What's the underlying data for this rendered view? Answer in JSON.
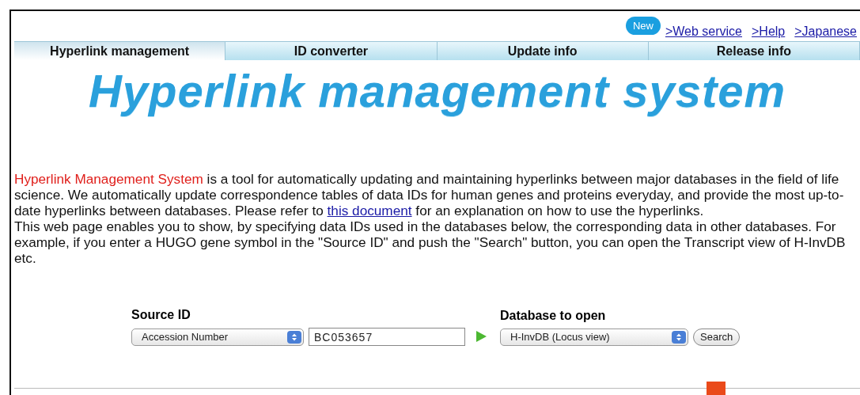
{
  "badge": "New",
  "top_links": [
    ">Web service",
    ">Help",
    ">Japanese"
  ],
  "tabs": [
    {
      "label": "Hyperlink management",
      "selected": true
    },
    {
      "label": "ID converter",
      "selected": false
    },
    {
      "label": "Update info",
      "selected": false
    },
    {
      "label": "Release info",
      "selected": false
    }
  ],
  "logo": "Hyperlink management system",
  "intro": {
    "highlight": "Hyperlink Management System",
    "text_before_link": " is a tool for automatically updating and maintaining hyperlinks between major databases in the field of life science. We automatically update correspondence tables of data IDs for human genes and proteins everyday, and provide the most up-to-date hyperlinks between databases. Please refer to ",
    "link": "this document",
    "text_after_link": " for an explanation on how to use the hyperlinks."
  },
  "description": "This web page enables you to show, by specifying data IDs used in the databases below, the corresponding data in other databases. For example, if you enter a HUGO gene symbol in the \"Source ID\" and push the \"Search\" button, you can open the Transcript view of H-InvDB etc.",
  "form": {
    "source_label": "Source ID",
    "source_type": "Accession Number",
    "source_value": "BC053657",
    "target_label": "Database to open",
    "target_db": "H-InvDB (Locus view)",
    "button": "Search"
  }
}
